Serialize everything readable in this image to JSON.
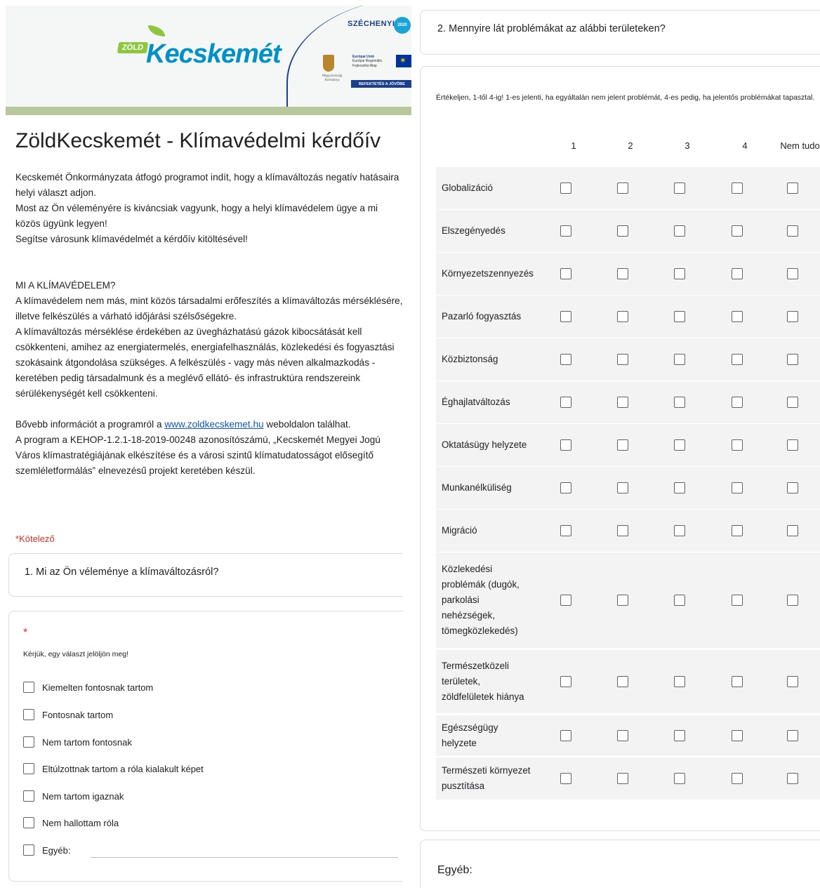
{
  "banner": {
    "logo_prefix": "ZÖLD",
    "logo_text": "Kecskemét",
    "szechenyi": "SZÉCHENYI",
    "szechenyi_badge": "2020",
    "gov_label": "Magyarország Kormánya",
    "eu_line1": "Európai Unió",
    "eu_line2": "Európai Regionális",
    "eu_line3": "Fejlesztési Alap",
    "invest_label": "BEFEKTETÉS A JÖVŐBE"
  },
  "form": {
    "title": "ZöldKecskemét - Klímavédelmi kérdőív",
    "intro": "Kecskemét Önkormányzata  átfogó programot indít, hogy a klímaváltozás negatív hatásaira helyi választ adjon.\nMost az Ön véleményére is kiváncsiak vagyunk, hogy a helyi klímavédelem ügye a mi közös ügyünk legyen!\nSegítse városunk klímavédelmét a kérdőív kitöltésével!",
    "what_heading": "MI A KLÍMAVÉDELEM?",
    "what_body": "A klímavédelem nem más, mint közös társadalmi erőfeszítés a klímaváltozás mérséklésére, illetve felkészülés a várható időjárási szélsőségekre.\nA klímaváltozás mérséklése érdekében az üvegházhatású gázok kibocsátását kell csökkenteni, amihez az energiatermelés, energiafelhasználás, közlekedési és fogyasztási szokásaink átgondolása szükséges. A felkészülés - vagy más néven alkalmazkodás - keretében pedig társadalmunk és a meglévő ellátó- és infrastruktúra rendszereink sérülékenységét kell csökkenteni.",
    "more_prefix": "Bővebb információt a programról a ",
    "more_link": "www.zoldkecskemet.hu",
    "more_suffix": "  weboldalon találhat.",
    "project": "A program a KEHOP-1.2.1-18-2019-00248 azonosítószámú, „Kecskemét Megyei Jogú Város klímastratégiájának elkészítése és a városi szintű klímatudatosságot elősegítő szemléletformálás” elnevezésű projekt keretében készül.",
    "required_note": "*Kötelező"
  },
  "q1": {
    "title": "1. Mi az Ön véleménye a klímaváltozásról?",
    "star": "*",
    "hint": "Kérjük, egy választ jelöljön meg!",
    "options": [
      "Kiemelten fontosnak tartom",
      "Fontosnak tartom",
      "Nem tartom fontosnak",
      "Eltúlzottnak tartom a róla kialakult képet",
      "Nem tartom igaznak",
      "Nem hallottam róla",
      "Egyéb:"
    ]
  },
  "q2": {
    "title": "2. Mennyire lát problémákat az alábbi területeken?",
    "instructions": "Értékeljen, 1-től 4-ig! 1-es jelenti, ha egyáltalán nem jelent problémát, 4-es pedig, ha jelentős problémákat tapasztal.",
    "columns": [
      "1",
      "2",
      "3",
      "4",
      "Nem tudom"
    ],
    "rows": [
      "Globalizáció",
      "Elszegényedés",
      "Környezetszennyezés",
      "Pazarló fogyasztás",
      "Közbiztonság",
      "Éghajlatváltozás",
      "Oktatásügy helyzete",
      "Munkanélküliség",
      "Migráció",
      "Közlekedési\nproblémák (dugók,\nparkolási\nnehézségek,\ntömegközlekedés)",
      "Természetközeli\nterületek,\nzöldfelületek hiánya",
      "Egészségügy\nhelyzete",
      "Természeti környezet\npusztítása"
    ]
  },
  "other": {
    "label": "Egyéb:"
  }
}
